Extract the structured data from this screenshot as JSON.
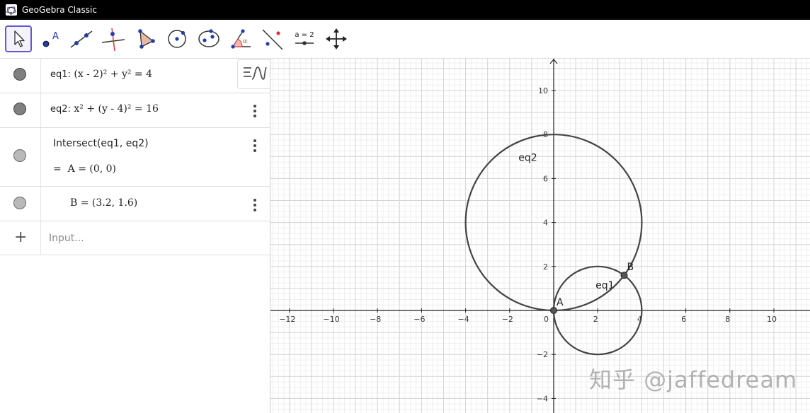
{
  "window": {
    "title": "GeoGebra Classic"
  },
  "toolbar": {
    "tools": [
      {
        "name": "move-tool",
        "selected": true
      },
      {
        "name": "point-tool",
        "glyph": "A"
      },
      {
        "name": "line-tool"
      },
      {
        "name": "perpendicular-line-tool"
      },
      {
        "name": "polygon-tool"
      },
      {
        "name": "circle-center-point-tool"
      },
      {
        "name": "ellipse-tool"
      },
      {
        "name": "angle-tool",
        "glyph": "α"
      },
      {
        "name": "reflect-tool"
      },
      {
        "name": "slider-tool",
        "glyph": "a = 2"
      },
      {
        "name": "move-graphics-view-tool"
      }
    ]
  },
  "algebra": {
    "rows": [
      {
        "label": "eq1:",
        "expression": "(x - 2)² + y² = 4",
        "marker": "dark"
      },
      {
        "label": "eq2:",
        "expression": "x² + (y - 4)² = 16",
        "marker": "dark"
      },
      {
        "command": "Intersect(eq1, eq2)",
        "result_prefix": "=",
        "result": "A = (0, 0)",
        "marker": "light"
      },
      {
        "result": "B = (3.2, 1.6)",
        "marker": "light"
      }
    ],
    "input_placeholder": "Input...",
    "add_icon": "+"
  },
  "graphics": {
    "x_ticks": [
      -12,
      -10,
      -8,
      -6,
      -4,
      -2,
      2,
      4,
      6,
      8,
      10
    ],
    "y_ticks": [
      -4,
      -2,
      2,
      4,
      6,
      8,
      10
    ],
    "origin_label": "0",
    "circles": [
      {
        "name": "eq1",
        "center": [
          2,
          0
        ],
        "radius": 2,
        "label": "eq1",
        "label_at": [
          1.9,
          1.0
        ]
      },
      {
        "name": "eq2",
        "center": [
          0,
          4
        ],
        "radius": 4,
        "label": "eq2",
        "label_at": [
          -1.6,
          6.8
        ]
      }
    ],
    "points": [
      {
        "name": "A",
        "x": 0,
        "y": 0,
        "label": "A"
      },
      {
        "name": "B",
        "x": 3.2,
        "y": 1.6,
        "label": "B"
      }
    ],
    "colors": {
      "curve": "#444444",
      "grid_minor": "#efefef",
      "grid_major": "#d5d5d5",
      "axis": "#222222"
    }
  },
  "watermark": "知乎 @jaffedream"
}
